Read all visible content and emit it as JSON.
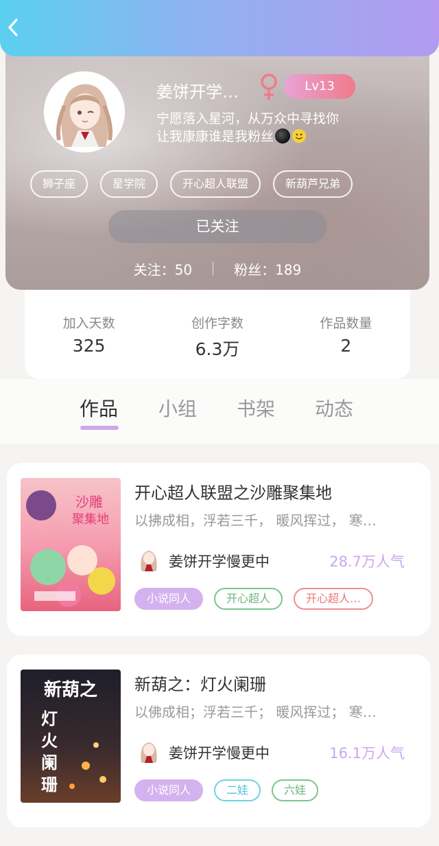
{
  "header": {
    "back_icon": "chevron-left-icon",
    "gradient": [
      "#5bd0f0",
      "#b39af0"
    ]
  },
  "profile": {
    "username": "姜饼开学…",
    "gender_icon": "female-icon",
    "gender_color": "#f07a8a",
    "level": "Lv13",
    "bio_line1": "宁愿落入星河，从万众中寻找你",
    "bio_line2": "让我康康谁是我粉丝",
    "tags": [
      "狮子座",
      "星学院",
      "开心超人联盟",
      "新葫芦兄弟"
    ],
    "follow_button": "已关注",
    "following": "关注：50",
    "followers": "粉丝：189"
  },
  "stats": [
    {
      "label": "加入天数",
      "value": "325"
    },
    {
      "label": "创作字数",
      "value": "6.3万"
    },
    {
      "label": "作品数量",
      "value": "2"
    }
  ],
  "tabs": [
    "作品",
    "小组",
    "书架",
    "动态"
  ],
  "active_tab": "作品",
  "accent_color": "#c9a8ec",
  "works": [
    {
      "title": "开心超人联盟之沙雕聚集地",
      "desc": "以拂成相，浮若三千， 暖风挥过， 寒…",
      "author": "姜饼开学慢更中",
      "popularity": "28.7万人气",
      "tags": [
        {
          "label": "小说同人",
          "style": "filled"
        },
        {
          "label": "开心超人",
          "style": "green"
        },
        {
          "label": "开心超人…",
          "style": "red"
        }
      ],
      "cover_text": "沙雕聚集地"
    },
    {
      "title": "新葫之：灯火阑珊",
      "desc": "以佛成相；浮若三千； 暖风挥过； 寒…",
      "author": "姜饼开学慢更中",
      "popularity": "16.1万人气",
      "tags": [
        {
          "label": "小说同人",
          "style": "filled"
        },
        {
          "label": "二娃",
          "style": "cyan"
        },
        {
          "label": "六娃",
          "style": "green"
        }
      ],
      "cover_text": "新葫之灯火阑珊"
    }
  ]
}
